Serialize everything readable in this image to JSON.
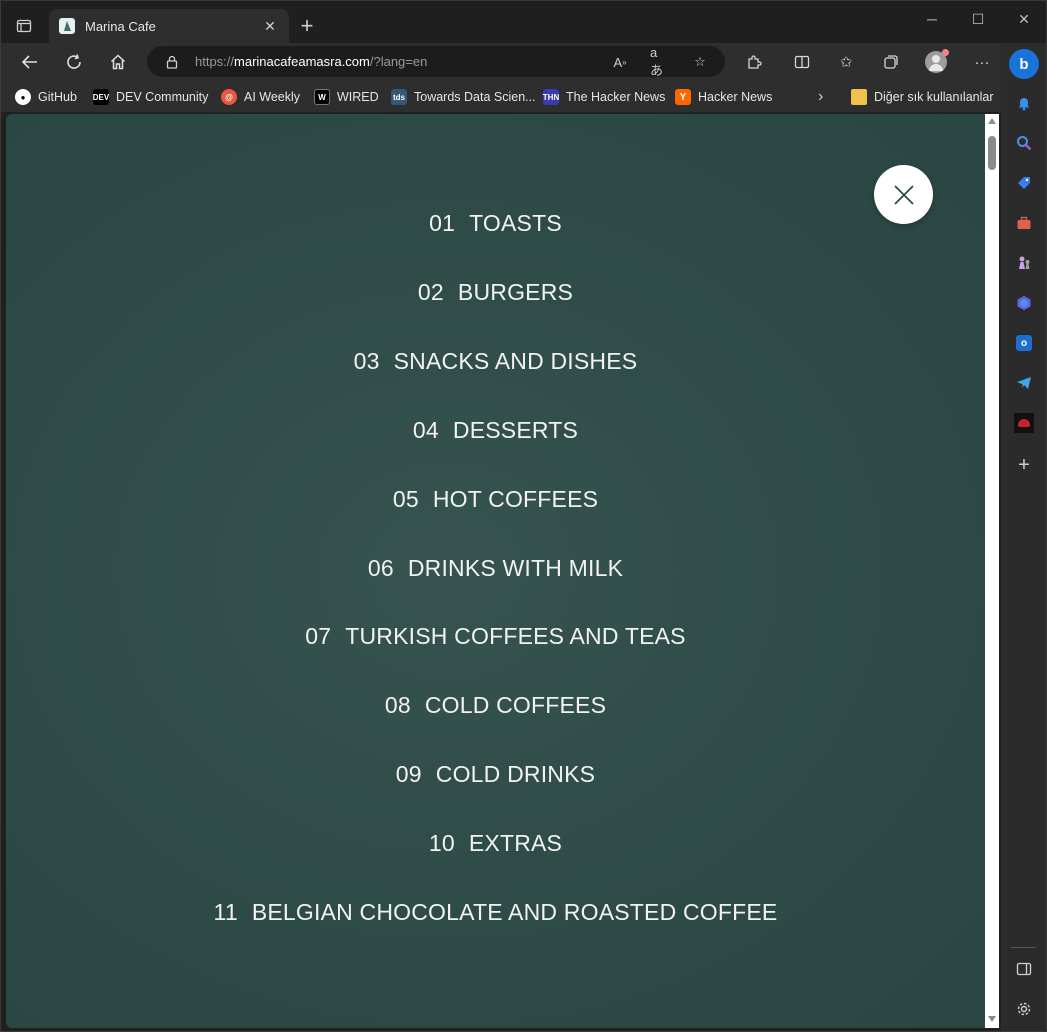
{
  "browser": {
    "tab_title": "Marina Cafe",
    "url_scheme": "https://",
    "url_host": "marinacafeamasra.com",
    "url_path": "/?lang=en"
  },
  "bookmarks": [
    {
      "label": "GitHub",
      "icon": "github-icon"
    },
    {
      "label": "DEV Community",
      "icon": "dev-icon"
    },
    {
      "label": "AI Weekly",
      "icon": "ai-weekly-icon"
    },
    {
      "label": "WIRED",
      "icon": "wired-icon"
    },
    {
      "label": "Towards Data Scien...",
      "icon": "tds-icon"
    },
    {
      "label": "The Hacker News",
      "icon": "thn-icon"
    },
    {
      "label": "Hacker News",
      "icon": "ycombinator-icon"
    }
  ],
  "bookmarks_folder": "Diğer sık kullanılanlar",
  "menu": {
    "items": [
      {
        "num": "01",
        "label": "TOASTS"
      },
      {
        "num": "02",
        "label": "BURGERS"
      },
      {
        "num": "03",
        "label": "SNACKS AND DISHES"
      },
      {
        "num": "04",
        "label": "DESSERTS"
      },
      {
        "num": "05",
        "label": "HOT COFFEES"
      },
      {
        "num": "06",
        "label": "DRINKS WITH MILK"
      },
      {
        "num": "07",
        "label": "TURKISH COFFEES AND TEAS"
      },
      {
        "num": "08",
        "label": "COLD COFFEES"
      },
      {
        "num": "09",
        "label": "COLD DRINKS"
      },
      {
        "num": "10",
        "label": "EXTRAS"
      },
      {
        "num": "11",
        "label": "BELGIAN CHOCOLATE AND ROASTED COFFEE"
      }
    ]
  },
  "colors": {
    "page_bg": "#2e4b47",
    "menu_text": "#f2f2f2",
    "browser_chrome": "#2e2e2e"
  }
}
